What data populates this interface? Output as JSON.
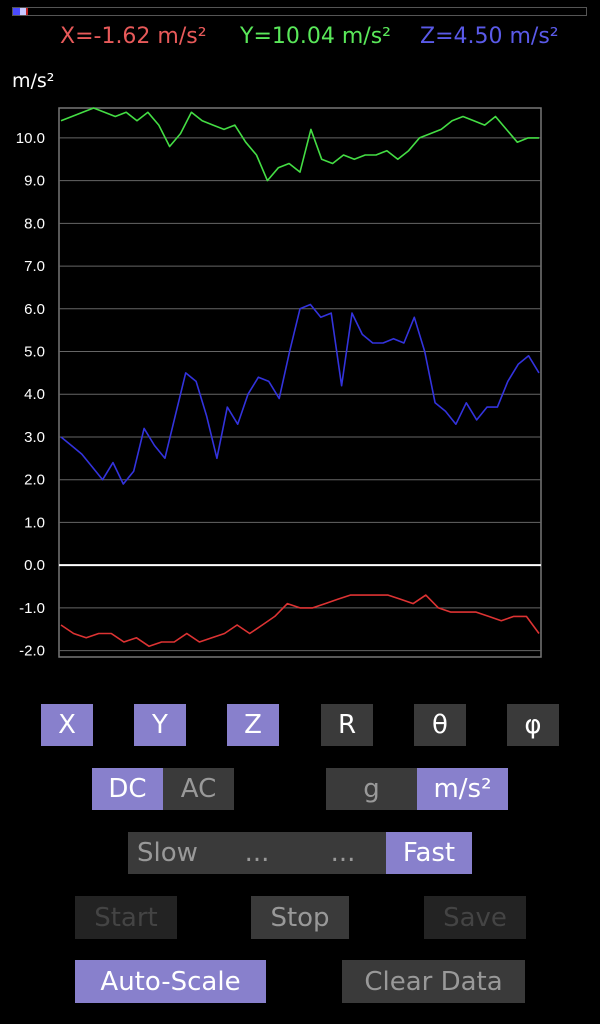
{
  "progress": {
    "fraction": 0.02,
    "colors": [
      "#4a4aff",
      "#c8c8ff",
      "#c02020"
    ]
  },
  "readouts": {
    "x": {
      "text": "X=-1.62 m/s²",
      "color": "#e85a5a"
    },
    "y": {
      "text": "Y=10.04 m/s²",
      "color": "#5ae85a"
    },
    "z": {
      "text": "Z=4.50 m/s²",
      "color": "#5a5ae8"
    }
  },
  "chart_data": {
    "type": "line",
    "ylabel": "m/s²",
    "ylim": [
      -2.15,
      10.7
    ],
    "yticks": [
      "10.0",
      "9.0",
      "8.0",
      "7.0",
      "6.0",
      "5.0",
      "4.0",
      "3.0",
      "2.0",
      "1.0",
      "0.0",
      "-1.0",
      "-2.0"
    ],
    "grid": true,
    "zero_line": true,
    "series": [
      {
        "key": "y",
        "color": "#44dd44",
        "values": [
          10.4,
          10.5,
          10.6,
          10.7,
          10.6,
          10.5,
          10.6,
          10.4,
          10.6,
          10.3,
          9.8,
          10.1,
          10.6,
          10.4,
          10.3,
          10.2,
          10.3,
          9.9,
          9.6,
          9.0,
          9.3,
          9.4,
          9.2,
          10.2,
          9.5,
          9.4,
          9.6,
          9.5,
          9.6,
          9.6,
          9.7,
          9.5,
          9.7,
          10.0,
          10.1,
          10.2,
          10.4,
          10.5,
          10.4,
          10.3,
          10.5,
          10.2,
          9.9,
          10.0,
          10.0
        ]
      },
      {
        "key": "z",
        "color": "#3333dd",
        "values": [
          3.0,
          2.8,
          2.6,
          2.3,
          2.0,
          2.4,
          1.9,
          2.2,
          3.2,
          2.8,
          2.5,
          3.5,
          4.5,
          4.3,
          3.5,
          2.5,
          3.7,
          3.3,
          4.0,
          4.4,
          4.3,
          3.9,
          5.0,
          6.0,
          6.1,
          5.8,
          5.9,
          4.2,
          5.9,
          5.4,
          5.2,
          5.2,
          5.3,
          5.2,
          5.8,
          5.0,
          3.8,
          3.6,
          3.3,
          3.8,
          3.4,
          3.7,
          3.7,
          4.3,
          4.7,
          4.9,
          4.5
        ]
      },
      {
        "key": "x",
        "color": "#dd3333",
        "values": [
          -1.4,
          -1.6,
          -1.7,
          -1.6,
          -1.6,
          -1.8,
          -1.7,
          -1.9,
          -1.8,
          -1.8,
          -1.6,
          -1.8,
          -1.7,
          -1.6,
          -1.4,
          -1.6,
          -1.4,
          -1.2,
          -0.9,
          -1.0,
          -1.0,
          -0.9,
          -0.8,
          -0.7,
          -0.7,
          -0.7,
          -0.7,
          -0.8,
          -0.9,
          -0.7,
          -1.0,
          -1.1,
          -1.1,
          -1.1,
          -1.2,
          -1.3,
          -1.2,
          -1.2,
          -1.6
        ]
      }
    ]
  },
  "buttons": {
    "x": "X",
    "y": "Y",
    "z": "Z",
    "r": "R",
    "theta": "θ",
    "phi": "φ",
    "dc": "DC",
    "ac": "AC",
    "g": "g",
    "ms2": "m/s²",
    "slow": "Slow",
    "mid1": "...",
    "mid2": "...",
    "fast": "Fast",
    "start": "Start",
    "stop": "Stop",
    "save": "Save",
    "autoscale": "Auto-Scale",
    "clear": "Clear Data"
  },
  "colors": {
    "active": "#8880cc",
    "inactive": "#3a3a3a",
    "disabled": "#232323"
  }
}
